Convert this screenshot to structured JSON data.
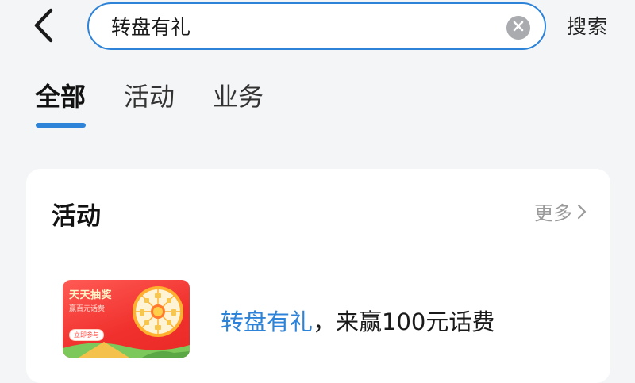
{
  "header": {
    "search_value": "转盘有礼",
    "search_button_label": "搜索"
  },
  "tabs": [
    {
      "label": "全部",
      "active": true
    },
    {
      "label": "活动",
      "active": false
    },
    {
      "label": "业务",
      "active": false
    }
  ],
  "activity_section": {
    "title": "活动",
    "more_label": "更多",
    "items": [
      {
        "title_highlight": "转盘有礼",
        "title_rest": "，来赢100元话费",
        "thumbnail": {
          "title": "天天抽奖",
          "subtitle": "赢百元话费",
          "button_label": "立即参与"
        }
      }
    ]
  },
  "colors": {
    "accent": "#2d83d8",
    "background": "#f4f5f7",
    "card": "#ffffff",
    "thumbnail_red": "#f0302c"
  },
  "icons": {
    "back": "chevron-left-icon",
    "clear": "clear-circle-icon",
    "more": "chevron-right-icon"
  }
}
